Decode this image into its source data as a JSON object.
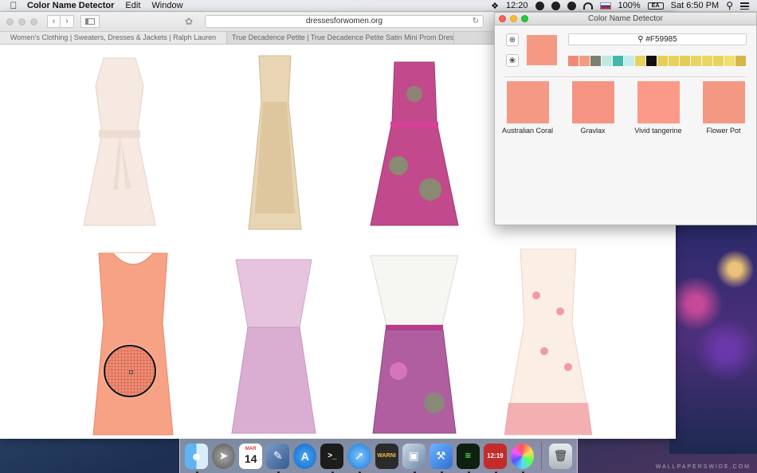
{
  "menubar": {
    "app_name": "Color Name Detector",
    "menus": [
      "Edit",
      "Window"
    ],
    "time_left": "12:20",
    "battery": "100%",
    "battery_icon_text": "EA",
    "clock": "Sat 6:50 PM"
  },
  "browser": {
    "url": "dressesforwomen.org",
    "tabs": [
      {
        "label": "Women's Clothing | Sweaters, Dresses & Jackets | Ralph Lauren"
      },
      {
        "label": "True Decadence Petite | True Decadence Petite Satin Mini Prom Dres..."
      }
    ]
  },
  "products": [
    {
      "name": "cream-lace-dress",
      "colors": {
        "main": "#f5e9e1",
        "accent": "#eddcd0"
      }
    },
    {
      "name": "gold-floral-maxi-dress",
      "colors": {
        "main": "#e8d5b4",
        "accent": "#d6b98e"
      }
    },
    {
      "name": "pink-floral-dress",
      "colors": {
        "main": "#c24a8c",
        "accent": "#7a9a6a"
      }
    },
    {
      "name": "coral-shift-dress",
      "colors": {
        "main": "#f7a284",
        "accent": "#f08a6c"
      }
    },
    {
      "name": "lilac-pleated-dress",
      "colors": {
        "main": "#e6c4de",
        "accent": "#d9aed2"
      }
    },
    {
      "name": "white-bodice-floral-dress",
      "colors": {
        "main": "#f6f6f2",
        "accent": "#b05ea0"
      }
    },
    {
      "name": "pink-print-white-dress",
      "colors": {
        "main": "#fbeee4",
        "accent": "#f19aa2"
      }
    }
  ],
  "detector": {
    "title": "Color Name Detector",
    "current_color": "#F59985",
    "search_value": "#F59985",
    "palette": [
      "#f08a76",
      "#f29c82",
      "#7c8070",
      "#bfeae4",
      "#3fb9a7",
      "#c5ecec",
      "#e8d15a",
      "#111111",
      "#e6cf58",
      "#e9d25c",
      "#e4cd54",
      "#e8d45e",
      "#ead660",
      "#e6d45c",
      "#f1e06a",
      "#d6b648"
    ],
    "matches": [
      {
        "name": "Australian Coral",
        "color": "#f59985"
      },
      {
        "name": "Gravlax",
        "color": "#f69483"
      },
      {
        "name": "Vivid tangerine",
        "color": "#fb9a88"
      },
      {
        "name": "Flower Pot",
        "color": "#f39883"
      }
    ]
  },
  "dock": {
    "calendar_month": "MAR",
    "calendar_day": "14",
    "console_text": "WARNI",
    "clock_text": "12:19"
  },
  "wallpaper": {
    "credit": "WALLPAPERSWIDE.COM"
  }
}
